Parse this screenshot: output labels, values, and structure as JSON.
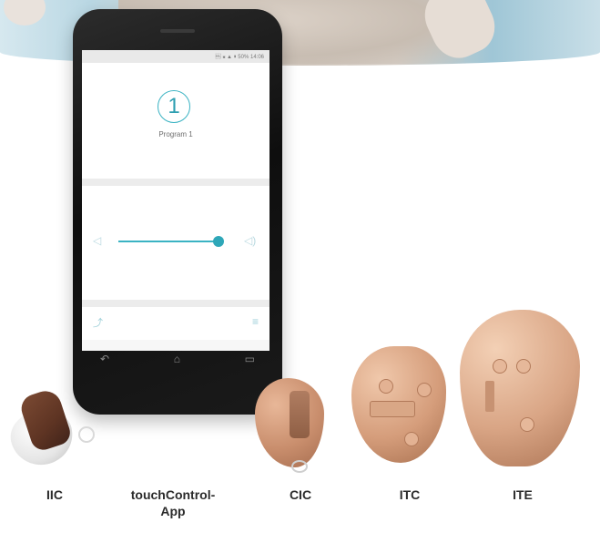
{
  "phone": {
    "status_text": "\u0007 ☸ ▲ ▮ 50% 14:06",
    "program_number": "1",
    "program_label": "Program 1",
    "nav_back": "↶",
    "nav_home": "⌂",
    "nav_recent": "▭"
  },
  "labels": {
    "iic": "IIC",
    "app": "touchControl-\nApp",
    "cic": "CIC",
    "itc": "ITC",
    "ite": "ITE"
  },
  "colors": {
    "accent": "#3bb3c3",
    "label_text": "#2b2b2b"
  }
}
